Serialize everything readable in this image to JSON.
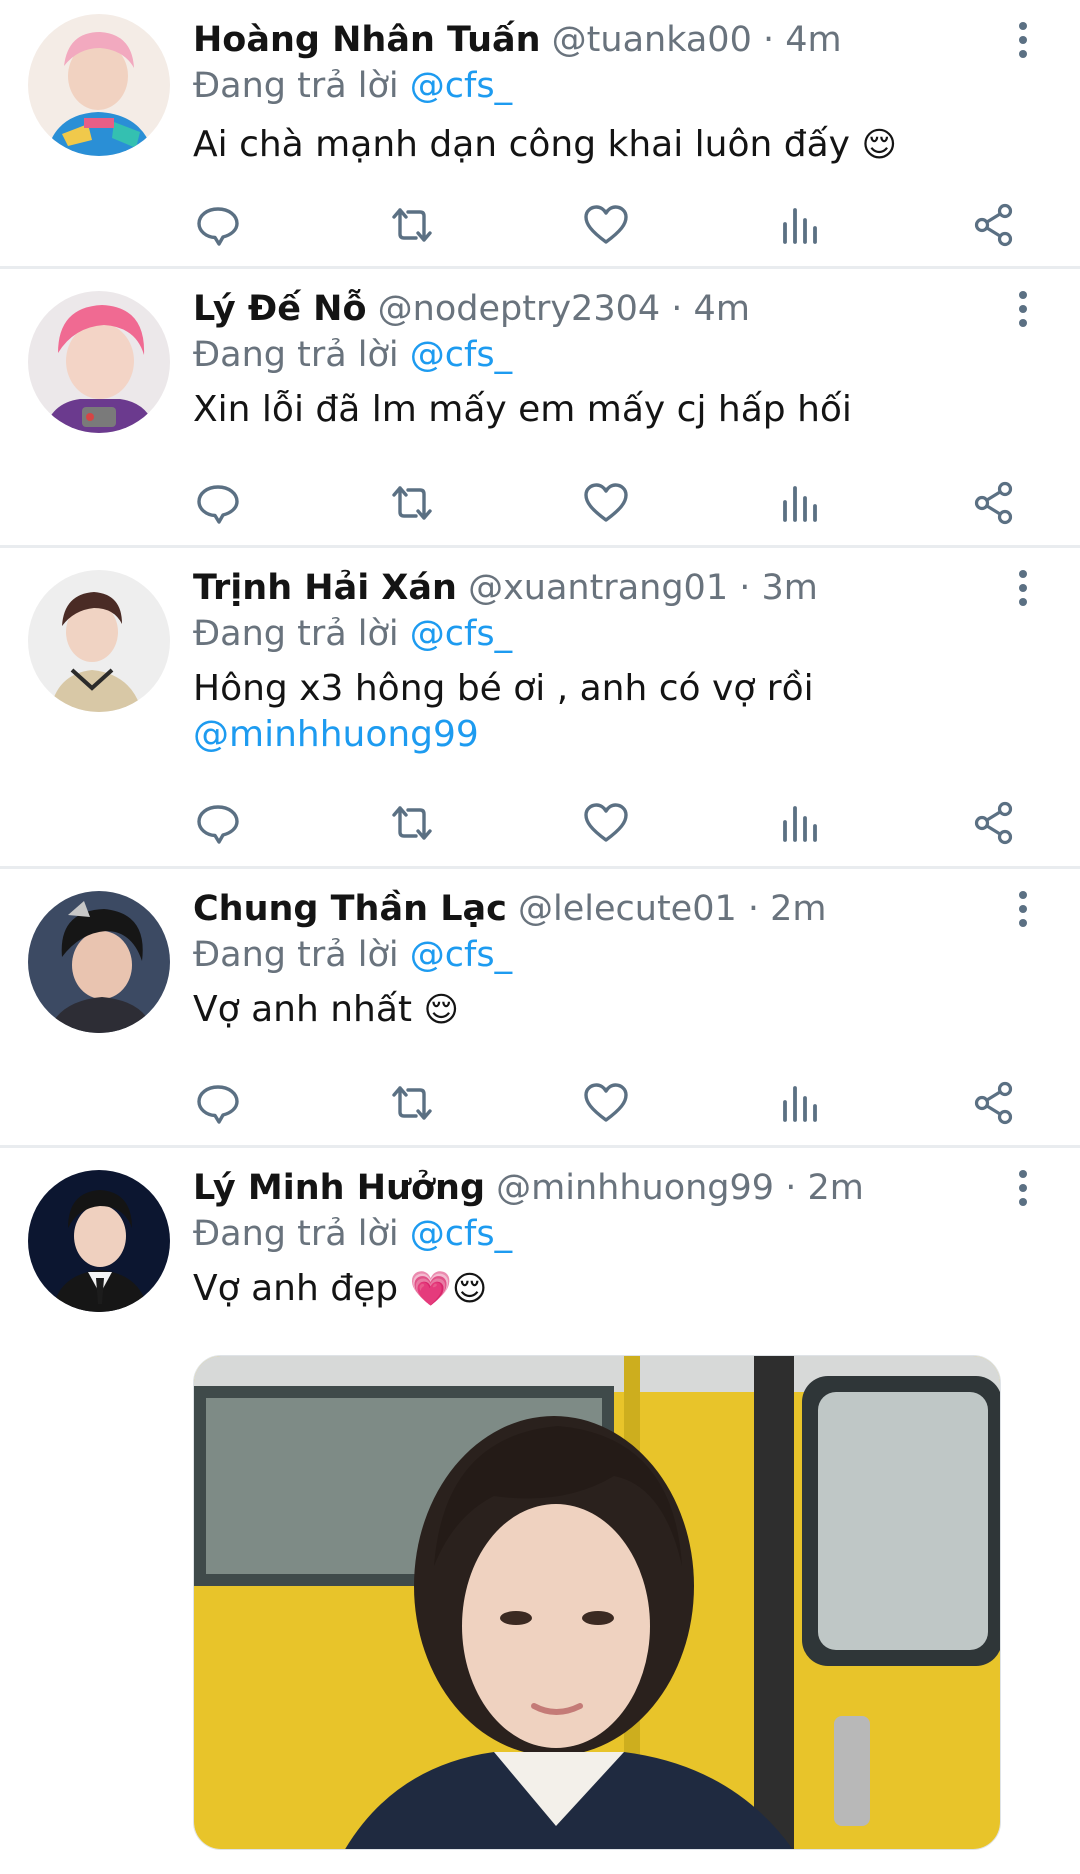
{
  "tweets": [
    {
      "name": "Hoàng Nhân Tuấn",
      "handle": "@tuanka00",
      "separator": "·",
      "time": "4m",
      "replying_prefix": "Đang trả lời",
      "replying_to": "@cfs_",
      "text": "Ai chà mạnh dạn công khai luôn đấy",
      "emoji": "😌"
    },
    {
      "name": "Lý Đế Nỗ",
      "handle": "@nodeptry2304",
      "separator": "·",
      "time": "4m",
      "replying_prefix": "Đang trả lời",
      "replying_to": "@cfs_",
      "text": "Xin lỗi đã lm mấy em mấy cj hấp hối"
    },
    {
      "name": "Trịnh Hải Xán",
      "handle": "@xuantrang01",
      "separator": "·",
      "time": "3m",
      "replying_prefix": "Đang trả lời",
      "replying_to": "@cfs_",
      "text": "Hông x3 hông bé ơi , anh có vợ rồi",
      "text_mention": "@minhhuong99"
    },
    {
      "name": "Chung Thần Lạc",
      "handle": "@lelecute01",
      "separator": "·",
      "time": "2m",
      "replying_prefix": "Đang trả lời",
      "replying_to": "@cfs_",
      "text": "Vợ anh nhất",
      "emoji": "😌"
    },
    {
      "name": "Lý Minh Hưởng",
      "handle": "@minhhuong99",
      "separator": "·",
      "time": "2m",
      "replying_prefix": "Đang trả lời",
      "replying_to": "@cfs_",
      "text": "Vợ anh đẹp",
      "emoji": "💗😌"
    }
  ],
  "icons": {
    "reply": "reply-icon",
    "retweet": "retweet-icon",
    "like": "heart-icon",
    "analytics": "analytics-icon",
    "share": "share-icon",
    "more": "more-vertical-icon"
  },
  "colors": {
    "link": "#1d9bf0",
    "secondary_text": "#69737d",
    "icon": "#5b7083",
    "divider": "#e9ecef"
  }
}
